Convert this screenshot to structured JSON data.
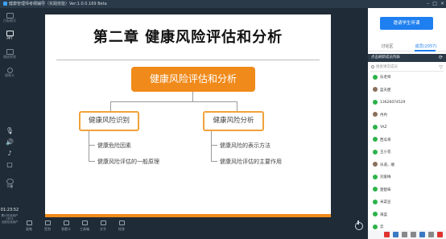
{
  "titlebar": {
    "text": "健康管理师考纲辅导（实践技能）Ver:1.0.0.169 Beta",
    "min": "–",
    "max": "□",
    "close": "×"
  },
  "left_toolbar": {
    "tools": [
      {
        "label": "白板模式",
        "icon": "whiteboard-icon",
        "active": false
      },
      {
        "label": "PPT",
        "icon": "ppt-icon",
        "active": true
      },
      {
        "label": "播放视频",
        "icon": "video-icon",
        "active": false
      },
      {
        "label": "摄像头",
        "icon": "camera-icon",
        "active": false
      }
    ],
    "mic_glyph": "🎙",
    "speaker_glyph": "🔊",
    "music_glyph": "♪",
    "more_glyph": "▢",
    "exit_label": "下课",
    "timer": "01:23:52",
    "info_line1": "累计在线用户",
    "info_line2": "1874",
    "info_line3": "当前在线用户"
  },
  "slide": {
    "title": "第二章 健康风险评估和分析",
    "main_box": "健康风险评估和分析",
    "left_box": "健康风险识别",
    "right_box": "健康风险分析",
    "left_items": [
      "健康危险因素",
      "健康风险评估的一般原理"
    ],
    "right_items": [
      "健康风险的表示方法",
      "健康风险评估的主要作用"
    ]
  },
  "bottom_toolbar": {
    "tools": [
      {
        "label": "画笔",
        "icon": "pen-icon"
      },
      {
        "label": "签到",
        "icon": "signin-icon"
      },
      {
        "label": "答题卡",
        "icon": "answer-card-icon"
      },
      {
        "label": "工具箱",
        "icon": "toolbox-icon"
      },
      {
        "label": "文字",
        "icon": "text-icon"
      },
      {
        "label": "抢答",
        "icon": "quick-answer-icon"
      }
    ]
  },
  "right_panel": {
    "handup_button": "邀请学生听课",
    "tabs": [
      "讨论区",
      "成员(2057)"
    ],
    "active_tab": 1,
    "members_header": "点击刷新成员列表",
    "refresh_glyph": "⟳",
    "search_placeholder": "搜索课堂成员",
    "filter_glyph": "▽",
    "members": [
      {
        "name": "乐老师",
        "kind": "wx"
      },
      {
        "name": "蓝天使",
        "kind": "ph"
      },
      {
        "name": "13626074529",
        "kind": "wx"
      },
      {
        "name": "冉冉",
        "kind": "ph"
      },
      {
        "name": "YAZ",
        "kind": "wx"
      },
      {
        "name": "西瓜哥",
        "kind": "wx"
      },
      {
        "name": "王小花",
        "kind": "wx"
      },
      {
        "name": "乐道，顺",
        "kind": "ph"
      },
      {
        "name": "刘爱梅",
        "kind": "wx"
      },
      {
        "name": "楚楚味",
        "kind": "wx"
      },
      {
        "name": "米菜豆",
        "kind": "wx"
      },
      {
        "name": "海蓝",
        "kind": "wx"
      },
      {
        "name": "云",
        "kind": "wx"
      }
    ]
  },
  "colors": {
    "accent": "#1e7ff0",
    "orange": "#f08a1a",
    "dark": "#1f2b36",
    "wechat": "#2cb24a"
  }
}
